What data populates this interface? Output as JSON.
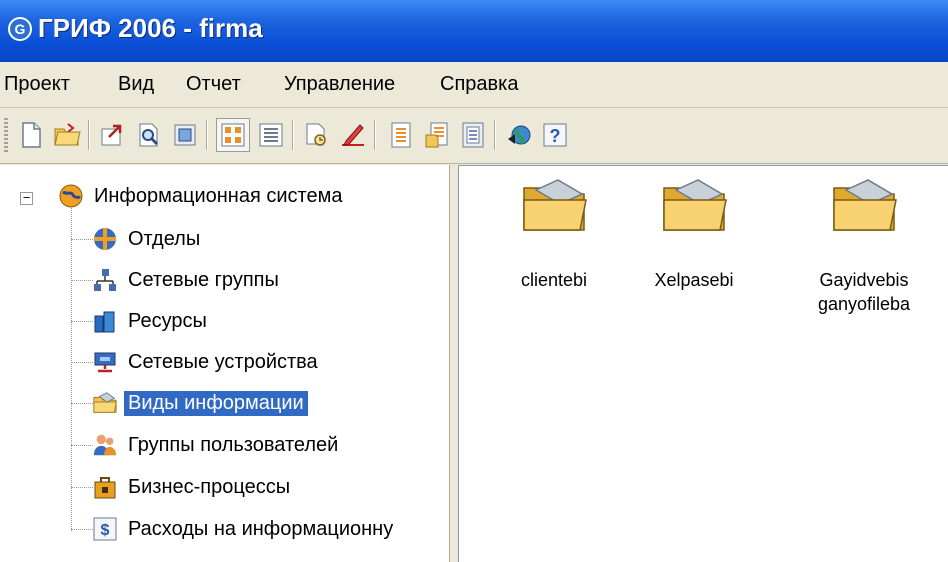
{
  "window": {
    "title": "ГРИФ 2006 - firma",
    "app_icon_letter": "G"
  },
  "menu": [
    "Проект",
    "Вид",
    "Отчет",
    "Управление",
    "Справка"
  ],
  "toolbar": {
    "buttons": [
      {
        "icon": "new-document-icon"
      },
      {
        "icon": "open-folder-icon"
      },
      {
        "icon": "export-icon"
      },
      {
        "icon": "print-preview-icon"
      },
      {
        "icon": "properties-icon"
      },
      {
        "icon": "large-icons-view-icon",
        "pressed": true
      },
      {
        "icon": "details-view-icon"
      },
      {
        "icon": "find-icon"
      },
      {
        "icon": "edit-pen-icon"
      },
      {
        "icon": "report-icon"
      },
      {
        "icon": "report-edit-icon"
      },
      {
        "icon": "report-list-icon"
      },
      {
        "icon": "web-update-icon"
      },
      {
        "icon": "help-icon"
      }
    ]
  },
  "tree": {
    "root": {
      "label": "Информационная система",
      "icon": "globe-icon",
      "expander": "−"
    },
    "items": [
      {
        "label": "Отделы",
        "icon": "departments-icon"
      },
      {
        "label": "Сетевые группы",
        "icon": "network-groups-icon"
      },
      {
        "label": "Ресурсы",
        "icon": "resources-icon"
      },
      {
        "label": "Сетевые устройства",
        "icon": "network-devices-icon"
      },
      {
        "label": "Виды информации",
        "icon": "folder-icon",
        "selected": true
      },
      {
        "label": "Группы пользователей",
        "icon": "user-groups-icon"
      },
      {
        "label": "Бизнес-процессы",
        "icon": "business-processes-icon"
      },
      {
        "label": "Расходы на информационну",
        "icon": "dollar-icon"
      }
    ]
  },
  "list": {
    "items": [
      {
        "label": "clientebi",
        "icon": "folder-icon"
      },
      {
        "label": "Xelpasebi",
        "icon": "folder-icon"
      },
      {
        "label": "Gayidvebis ganyofileba",
        "icon": "folder-icon"
      }
    ]
  },
  "colors": {
    "title_bar": "#0a4fd6",
    "selection": "#316ac5",
    "folder": "#f2c24f"
  }
}
